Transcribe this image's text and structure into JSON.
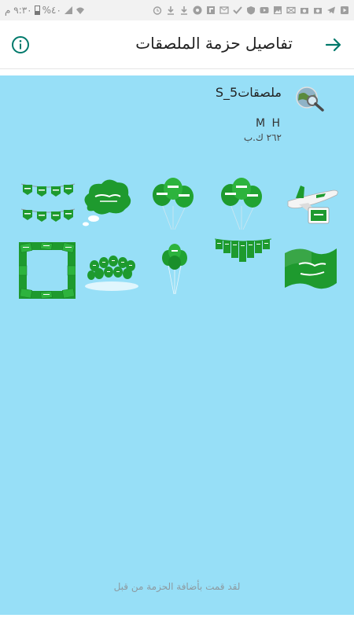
{
  "status_bar": {
    "time": "٩:٣٠ م",
    "battery": "%٤٠",
    "icons": [
      "signal-icon",
      "wifi-icon",
      "alarm-icon",
      "download-icon",
      "download-icon",
      "flipboard-icon",
      "chrome-icon",
      "f-icon",
      "mute-mail-icon",
      "check-icon",
      "shield-icon",
      "image-icon",
      "camera-icon",
      "camera-icon",
      "telegram-icon",
      "mail-icon",
      "youtube-icon",
      "play-icon"
    ]
  },
  "app_bar": {
    "title": "تفاصيل حزمة الملصقات",
    "info_icon": "info-icon",
    "back_icon": "arrow-forward-icon"
  },
  "pack": {
    "name": "ملصقات5_S",
    "author": "M H",
    "size": "٢٦٢ ك.ب",
    "tray_icon": "globe-magnifier-icon"
  },
  "stickers": [
    {
      "name": "sticker-airplane-flag"
    },
    {
      "name": "sticker-balloons-flag-a"
    },
    {
      "name": "sticker-balloons-flag-b"
    },
    {
      "name": "sticker-cloud-shahada"
    },
    {
      "name": "sticker-bunting-flags"
    },
    {
      "name": "sticker-waving-flag"
    },
    {
      "name": "sticker-flag-garland"
    },
    {
      "name": "sticker-balloon-bunch"
    },
    {
      "name": "sticker-balloon-crowd"
    },
    {
      "name": "sticker-flag-frame"
    }
  ],
  "footer_note": "لقد قمت بأضافة الحزمة من قبل",
  "colors": {
    "background": "#97dff7",
    "accent": "#00796b",
    "flag_green": "#1e9a2e"
  }
}
